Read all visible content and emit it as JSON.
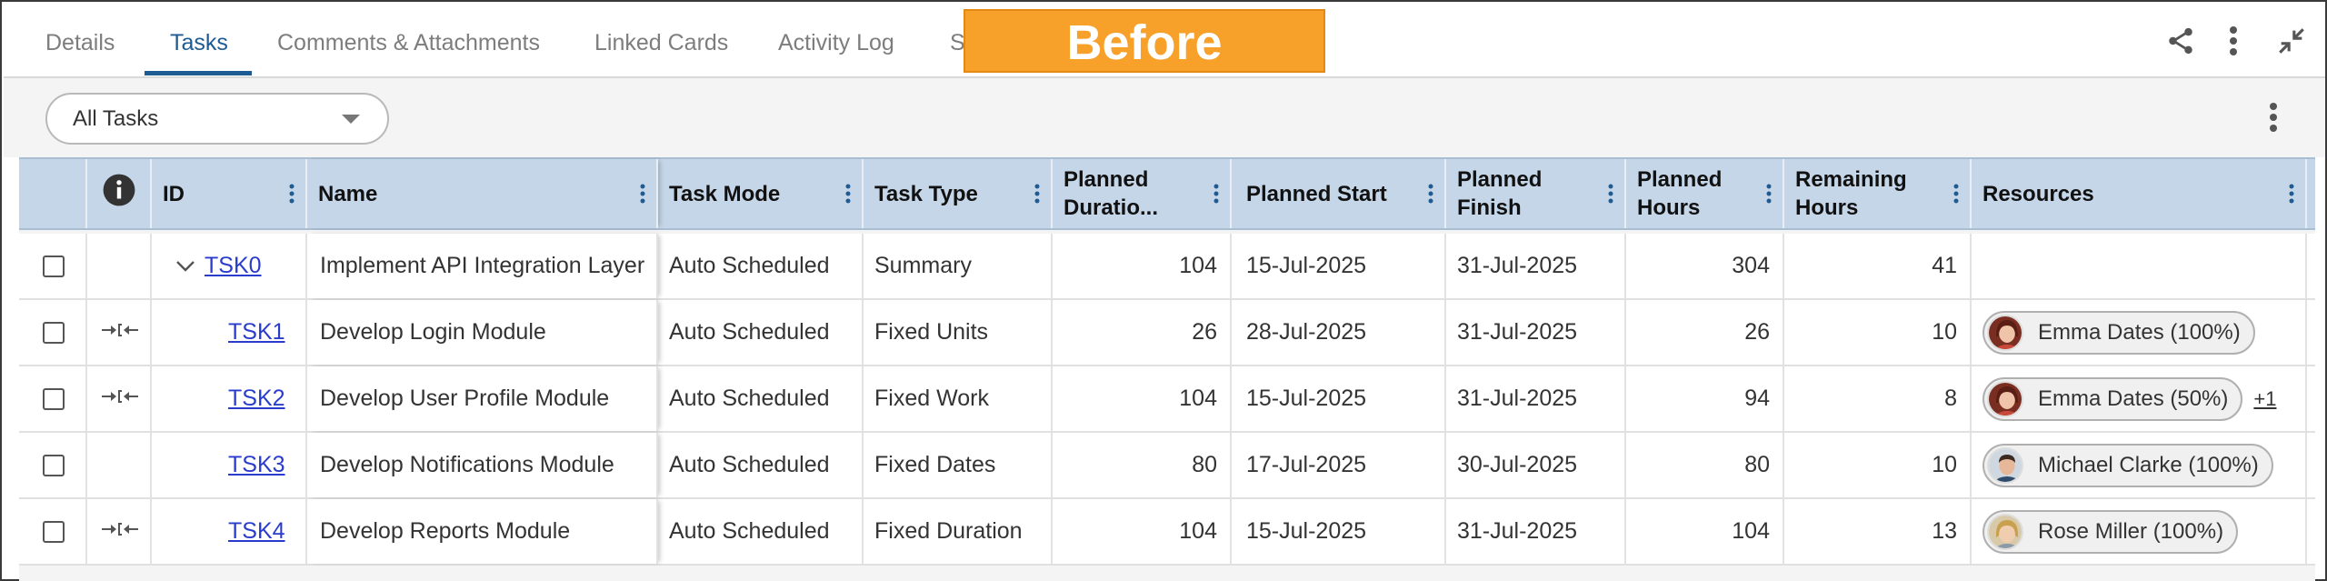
{
  "tabs": [
    {
      "label": "Details"
    },
    {
      "label": "Tasks"
    },
    {
      "label": "Comments & Attachments"
    },
    {
      "label": "Linked Cards"
    },
    {
      "label": "Activity Log"
    },
    {
      "label": "S"
    }
  ],
  "active_tab": "Tasks",
  "overlay_badge": "Before",
  "header_icons": [
    "share-icon",
    "more-vertical-icon",
    "collapse-icon"
  ],
  "filter": {
    "selected": "All Tasks"
  },
  "columns": {
    "info": "info-icon",
    "id": "ID",
    "name": "Name",
    "task_mode": "Task Mode",
    "task_type": "Task Type",
    "planned_duration": "Planned Duratio...",
    "planned_start": "Planned Start",
    "planned_finish": "Planned Finish",
    "planned_hours": "Planned Hours",
    "remaining_hours": "Remaining Hours",
    "resources": "Resources"
  },
  "rows": [
    {
      "id": "TSK0",
      "name": "Implement API Integration Layer",
      "task_mode": "Auto Scheduled",
      "task_type": "Summary",
      "planned_duration": "104",
      "planned_start": "15-Jul-2025",
      "planned_finish": "31-Jul-2025",
      "planned_hours": "304",
      "remaining_hours": "41",
      "resource": "",
      "extra": ""
    },
    {
      "id": "TSK1",
      "name": "Develop Login Module",
      "task_mode": "Auto Scheduled",
      "task_type": "Fixed Units",
      "planned_duration": "26",
      "planned_start": "28-Jul-2025",
      "planned_finish": "31-Jul-2025",
      "planned_hours": "26",
      "remaining_hours": "10",
      "resource": "Emma Dates (100%)",
      "extra": ""
    },
    {
      "id": "TSK2",
      "name": "Develop User Profile Module",
      "task_mode": "Auto Scheduled",
      "task_type": "Fixed Work",
      "planned_duration": "104",
      "planned_start": "15-Jul-2025",
      "planned_finish": "31-Jul-2025",
      "planned_hours": "94",
      "remaining_hours": "8",
      "resource": "Emma Dates (50%)",
      "extra": "+1"
    },
    {
      "id": "TSK3",
      "name": "Develop Notifications Module",
      "task_mode": "Auto Scheduled",
      "task_type": "Fixed Dates",
      "planned_duration": "80",
      "planned_start": "17-Jul-2025",
      "planned_finish": "30-Jul-2025",
      "planned_hours": "80",
      "remaining_hours": "10",
      "resource": "Michael Clarke (100%)",
      "extra": ""
    },
    {
      "id": "TSK4",
      "name": "Develop Reports Module",
      "task_mode": "Auto Scheduled",
      "task_type": "Fixed Duration",
      "planned_duration": "104",
      "planned_start": "15-Jul-2025",
      "planned_finish": "31-Jul-2025",
      "planned_hours": "104",
      "remaining_hours": "13",
      "resource": "Rose Miller (100%)",
      "extra": ""
    }
  ],
  "colors": {
    "accent": "#1f5b93",
    "header_bg": "#c5d6e8",
    "link": "#2a3ccc",
    "badge": "#f7a02a"
  }
}
